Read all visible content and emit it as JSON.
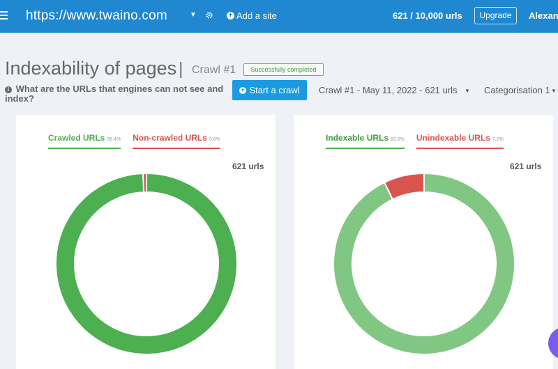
{
  "header": {
    "site_url": "https://www.twaino.com",
    "add_site_label": "Add a site",
    "quota": "621 / 10,000 urls",
    "upgrade_label": "Upgrade",
    "user_name": "Alexandre"
  },
  "page": {
    "title": "Indexability of pages",
    "separator": "|",
    "crawl_label": "Crawl #1",
    "status_badge": "Successfully completed",
    "question": "What are the URLs that engines can not see and index?",
    "start_crawl_label": "Start a crawl",
    "crawl_select": "Crawl #1 - May 11, 2022 - 621 urls",
    "categorisation_select": "Categorisation 1"
  },
  "colors": {
    "crawled": "#4caf50",
    "non_crawled": "#d9534f",
    "indexable": "#81c784",
    "unindexable": "#d9534f"
  },
  "chart_data": [
    {
      "type": "pie",
      "series": [
        {
          "name": "Crawled URLs",
          "percent_label": "99.4%",
          "value": 99.4,
          "color": "#4caf50"
        },
        {
          "name": "Non-crawled URLs",
          "percent_label": "0.6%",
          "value": 0.6,
          "color": "#d9534f"
        }
      ],
      "total_label": "621 urls"
    },
    {
      "type": "pie",
      "series": [
        {
          "name": "Indexable URLs",
          "percent_label": "92.8%",
          "value": 92.8,
          "color": "#81c784"
        },
        {
          "name": "Unindexable URLs",
          "percent_label": "7.2%",
          "value": 7.2,
          "color": "#d9534f"
        }
      ],
      "total_label": "621 urls"
    }
  ]
}
